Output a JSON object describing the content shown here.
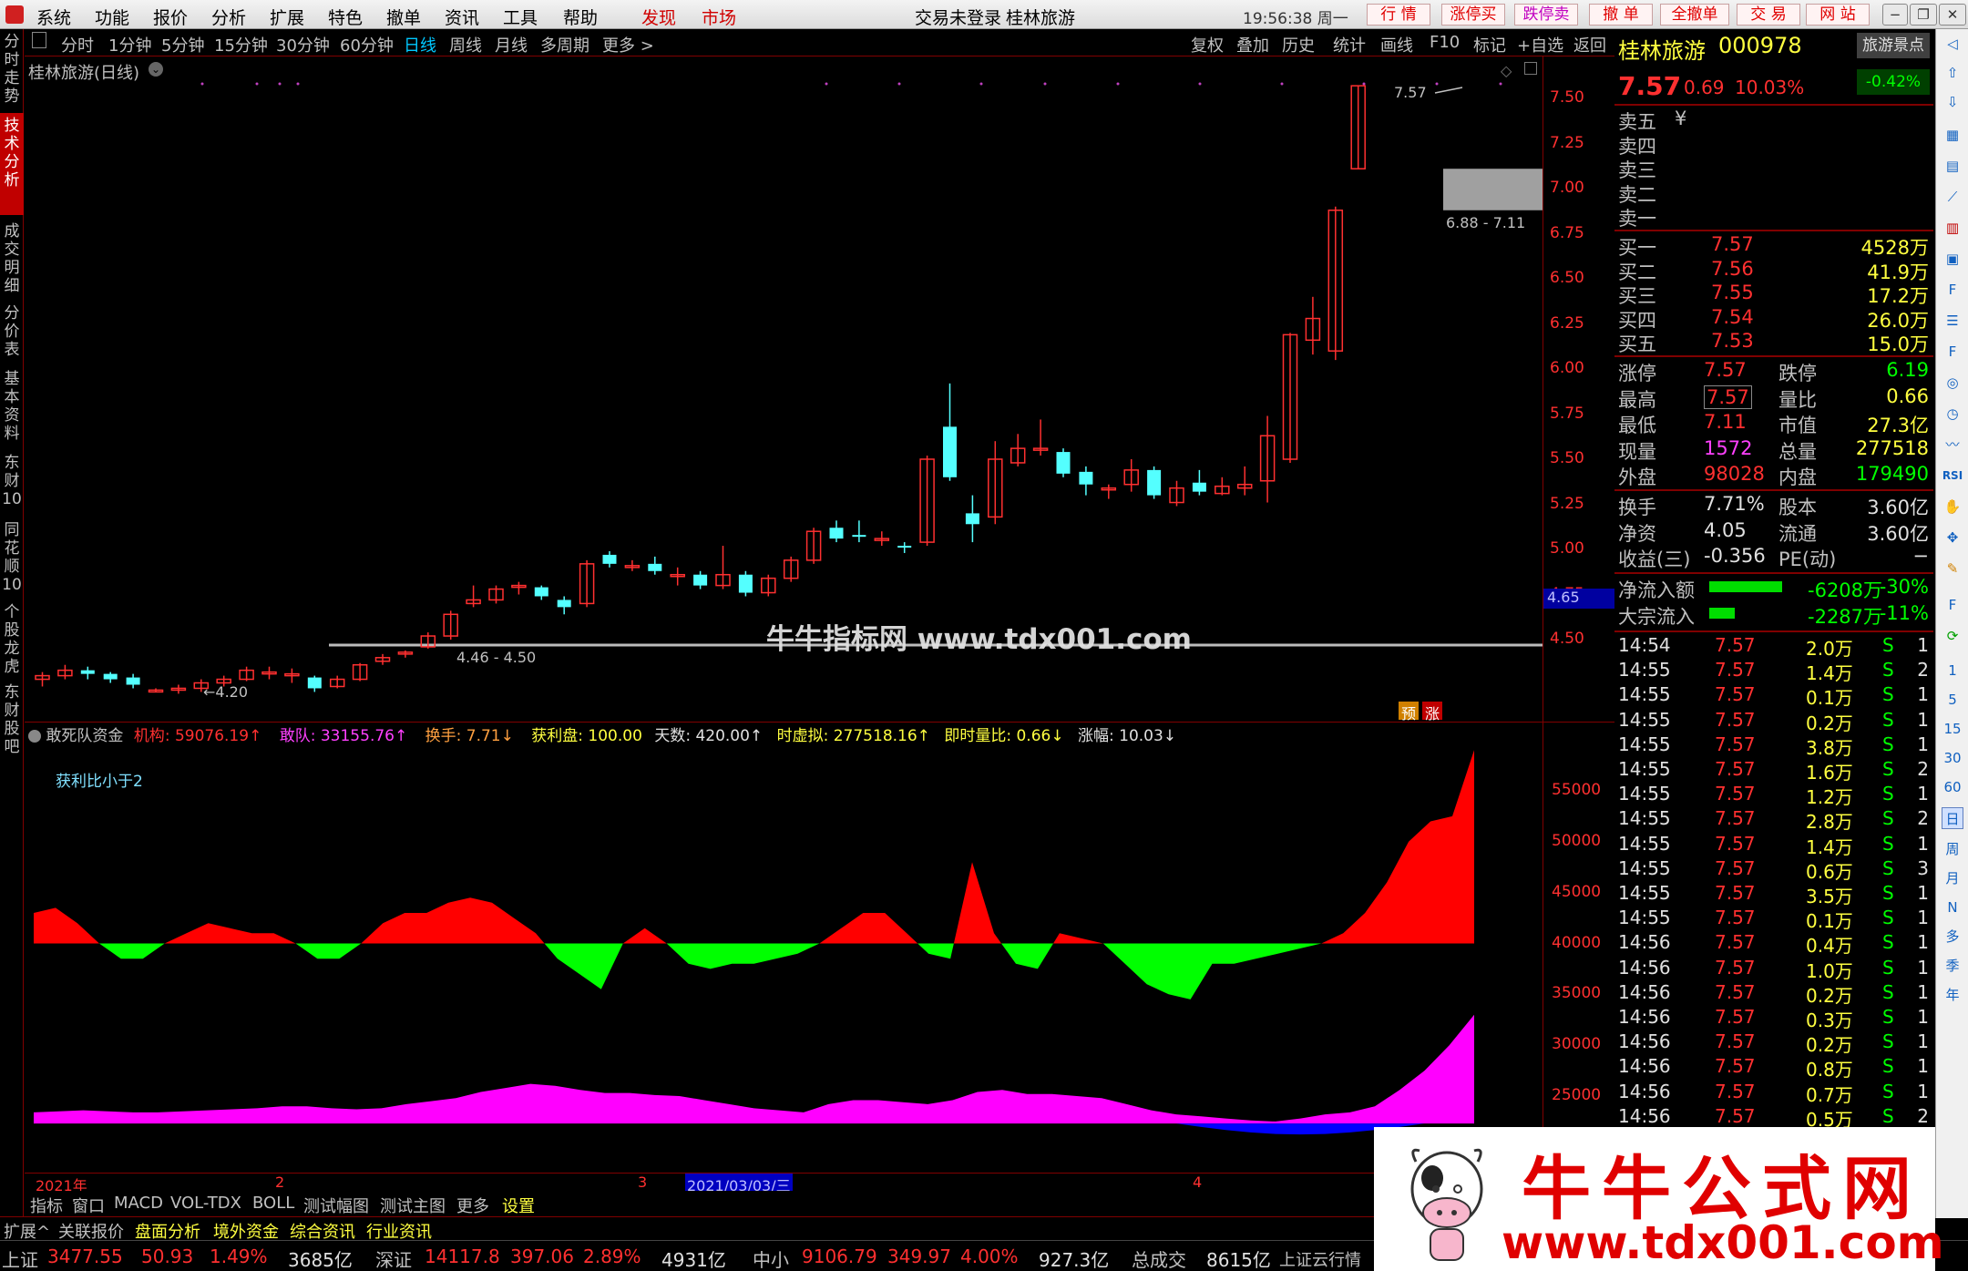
{
  "menubar": {
    "items": [
      "系统",
      "功能",
      "报价",
      "分析",
      "扩展",
      "特色",
      "撤单",
      "资讯",
      "工具",
      "帮助"
    ],
    "discover": "发现",
    "market": "市场",
    "login_status": "交易未登录",
    "stock_name": "桂林旅游",
    "clock": "19:56:38 周一",
    "buttons": [
      "行 情",
      "涨停买",
      "跌停卖",
      "撤 单",
      "全撤单",
      "交 易",
      "网 站"
    ],
    "window_controls": [
      "−",
      "❐",
      "□",
      "✕"
    ]
  },
  "leftbar": {
    "items": [
      "分时走势",
      "技术分析",
      "成交明细",
      "分价表",
      "基本资料",
      "东财10",
      "同花顺10",
      "个股龙虎",
      "东财股吧"
    ],
    "active": "技术分析"
  },
  "toolbar": {
    "periods": [
      "分时",
      "1分钟",
      "5分钟",
      "15分钟",
      "30分钟",
      "60分钟",
      "日线",
      "周线",
      "月线",
      "多周期",
      "更多 >"
    ],
    "active": "日线",
    "right": [
      "复权",
      "叠加",
      "历史",
      "统计",
      "画线",
      "F10",
      "标记",
      "+自选",
      "返回"
    ]
  },
  "main_chart": {
    "title": "桂林旅游(日线)",
    "y_labels": [
      "7.50",
      "7.25",
      "7.00",
      "6.75",
      "6.50",
      "6.25",
      "6.00",
      "5.75",
      "5.50",
      "5.25",
      "5.00",
      "4.75",
      "4.50"
    ],
    "current_price_tag": "4.65",
    "annotation_high": "7.57",
    "annotation_gap": "6.88 - 7.11",
    "annotation_support": "4.46 - 4.50",
    "annotation_low": "4.20",
    "badges": [
      "预",
      "涨"
    ],
    "watermark": "牛牛指标网 www.tdx001.com"
  },
  "chart_data": {
    "type": "candlestick",
    "ylim": [
      4.2,
      7.6
    ],
    "candles": [
      [
        4.28,
        4.3,
        4.24,
        4.32
      ],
      [
        4.3,
        4.33,
        4.28,
        4.36
      ],
      [
        4.33,
        4.31,
        4.28,
        4.35
      ],
      [
        4.31,
        4.28,
        4.26,
        4.32
      ],
      [
        4.29,
        4.25,
        4.23,
        4.31
      ],
      [
        4.22,
        4.22,
        4.21,
        4.23
      ],
      [
        4.22,
        4.23,
        4.2,
        4.25
      ],
      [
        4.23,
        4.26,
        4.21,
        4.28
      ],
      [
        4.26,
        4.28,
        4.24,
        4.3
      ],
      [
        4.28,
        4.33,
        4.27,
        4.35
      ],
      [
        4.32,
        4.32,
        4.28,
        4.35
      ],
      [
        4.31,
        4.31,
        4.26,
        4.34
      ],
      [
        4.29,
        4.23,
        4.21,
        4.3
      ],
      [
        4.24,
        4.28,
        4.23,
        4.3
      ],
      [
        4.28,
        4.36,
        4.27,
        4.37
      ],
      [
        4.38,
        4.4,
        4.36,
        4.42
      ],
      [
        4.42,
        4.43,
        4.4,
        4.44
      ],
      [
        4.46,
        4.52,
        4.45,
        4.54
      ],
      [
        4.52,
        4.64,
        4.5,
        4.66
      ],
      [
        4.7,
        4.72,
        4.68,
        4.8
      ],
      [
        4.72,
        4.78,
        4.7,
        4.8
      ],
      [
        4.8,
        4.8,
        4.75,
        4.82
      ],
      [
        4.79,
        4.74,
        4.72,
        4.8
      ],
      [
        4.72,
        4.68,
        4.64,
        4.74
      ],
      [
        4.7,
        4.92,
        4.68,
        4.94
      ],
      [
        4.97,
        4.92,
        4.9,
        4.99
      ],
      [
        4.91,
        4.91,
        4.88,
        4.94
      ],
      [
        4.92,
        4.88,
        4.86,
        4.96
      ],
      [
        4.86,
        4.86,
        4.8,
        4.9
      ],
      [
        4.86,
        4.8,
        4.78,
        4.88
      ],
      [
        4.8,
        4.86,
        4.78,
        5.02
      ],
      [
        4.86,
        4.76,
        4.74,
        4.88
      ],
      [
        4.76,
        4.84,
        4.74,
        4.86
      ],
      [
        4.84,
        4.94,
        4.82,
        4.96
      ],
      [
        4.94,
        5.1,
        4.92,
        5.12
      ],
      [
        5.12,
        5.06,
        5.04,
        5.16
      ],
      [
        5.08,
        5.07,
        5.04,
        5.16
      ],
      [
        5.06,
        5.06,
        5.02,
        5.1
      ],
      [
        5.02,
        5.01,
        4.98,
        5.04
      ],
      [
        5.04,
        5.5,
        5.02,
        5.52
      ],
      [
        5.68,
        5.4,
        5.38,
        5.92
      ],
      [
        5.2,
        5.14,
        5.04,
        5.3
      ],
      [
        5.18,
        5.5,
        5.14,
        5.6
      ],
      [
        5.48,
        5.56,
        5.46,
        5.64
      ],
      [
        5.56,
        5.56,
        5.52,
        5.72
      ],
      [
        5.54,
        5.42,
        5.4,
        5.56
      ],
      [
        5.43,
        5.36,
        5.3,
        5.46
      ],
      [
        5.34,
        5.34,
        5.28,
        5.36
      ],
      [
        5.36,
        5.44,
        5.32,
        5.5
      ],
      [
        5.44,
        5.3,
        5.28,
        5.46
      ],
      [
        5.26,
        5.34,
        5.24,
        5.38
      ],
      [
        5.37,
        5.32,
        5.3,
        5.44
      ],
      [
        5.31,
        5.35,
        5.3,
        5.4
      ],
      [
        5.34,
        5.36,
        5.3,
        5.46
      ],
      [
        5.38,
        5.63,
        5.26,
        5.74
      ],
      [
        5.5,
        6.19,
        5.48,
        6.2
      ],
      [
        6.16,
        6.28,
        6.08,
        6.4
      ],
      [
        6.1,
        6.88,
        6.05,
        6.9
      ],
      [
        7.11,
        7.57,
        7.11,
        7.57
      ]
    ],
    "gap_band": [
      6.88,
      7.11
    ],
    "support_line": 4.47
  },
  "indicator": {
    "name": "敢死队资金",
    "labels": [
      {
        "k": "机构",
        "v": "59076.19↑"
      },
      {
        "k": "敢队",
        "v": "33155.76↑"
      },
      {
        "k": "换手",
        "v": "7.71↓"
      },
      {
        "k": "获利盘",
        "v": "100.00"
      },
      {
        "k": "天数",
        "v": "420.00↑"
      },
      {
        "k": "时虚拟",
        "v": "277518.16↑"
      },
      {
        "k": "即时量比",
        "v": "0.66↓"
      },
      {
        "k": "涨幅",
        "v": "10.03↓"
      }
    ],
    "note": "获利比小于2",
    "y_labels": [
      "55000",
      "50000",
      "45000",
      "40000",
      "35000",
      "30000",
      "25000"
    ],
    "x_labels": [
      "2021年",
      "2",
      "3",
      "4"
    ],
    "cursor_date": "2021/03/03/三",
    "red_green_series": [
      43000,
      43500,
      42000,
      40000,
      38500,
      38500,
      40000,
      41000,
      42000,
      41500,
      41000,
      41000,
      40000,
      38500,
      38500,
      40000,
      42000,
      43000,
      43000,
      44000,
      44500,
      44000,
      42500,
      41000,
      38500,
      37000,
      35500,
      40000,
      41500,
      40000,
      38000,
      37500,
      38000,
      38000,
      38500,
      39000,
      40000,
      41500,
      43000,
      43000,
      41000,
      39000,
      38500,
      48000,
      41000,
      38000,
      37500,
      41000,
      40500,
      40000,
      38000,
      36000,
      35000,
      34500,
      38000,
      38000,
      38500,
      39000,
      39500,
      40000,
      41000,
      43000,
      46000,
      50000,
      52000,
      52500,
      59000
    ],
    "magenta_series": [
      23400,
      23500,
      23600,
      23500,
      23400,
      23400,
      23500,
      23600,
      23700,
      23800,
      24000,
      24000,
      23800,
      23700,
      23800,
      24200,
      24500,
      24800,
      25400,
      25800,
      26200,
      26000,
      25600,
      25300,
      25300,
      25100,
      25000,
      24600,
      24200,
      23800,
      23600,
      23400,
      24200,
      24600,
      24600,
      24400,
      24200,
      24600,
      25400,
      25600,
      25200,
      25200,
      25000,
      24800,
      24200,
      23600,
      23200,
      23000,
      22800,
      22600,
      22500,
      22800,
      23200,
      23400,
      24000,
      25600,
      27500,
      30000,
      33000
    ],
    "blue_series_range": [
      46,
      56
    ]
  },
  "quote": {
    "name": "桂林旅游",
    "code": "000978",
    "sector": "旅游景点",
    "sector_change": "-0.42%",
    "price": "7.57",
    "change": "0.69",
    "change_pct": "10.03%",
    "sells": [
      [
        "卖五",
        "¥"
      ],
      [
        "卖四",
        ""
      ],
      [
        "卖三",
        ""
      ],
      [
        "卖二",
        ""
      ],
      [
        "卖一",
        ""
      ]
    ],
    "buys": [
      [
        "买一",
        "7.57",
        "4528万"
      ],
      [
        "买二",
        "7.56",
        "41.9万"
      ],
      [
        "买三",
        "7.55",
        "17.2万"
      ],
      [
        "买四",
        "7.54",
        "26.0万"
      ],
      [
        "买五",
        "7.53",
        "15.0万"
      ]
    ],
    "stats": [
      [
        "涨停",
        "7.57",
        "跌停",
        "6.19"
      ],
      [
        "最高",
        "7.57",
        "量比",
        "0.66"
      ],
      [
        "最低",
        "7.11",
        "市值",
        "27.3亿"
      ],
      [
        "现量",
        "1572",
        "总量",
        "277518"
      ],
      [
        "外盘",
        "98028",
        "内盘",
        "179490"
      ]
    ],
    "stats2": [
      [
        "换手",
        "7.71%",
        "股本",
        "3.60亿"
      ],
      [
        "净资",
        "4.05",
        "流通",
        "3.60亿"
      ],
      [
        "收益(三)",
        "-0.356",
        "PE(动)",
        "−"
      ]
    ],
    "flow": [
      {
        "label": "净流入额",
        "value": "-6208万",
        "pct": "-30%",
        "bar": 0.85
      },
      {
        "label": "大宗流入",
        "value": "-2287万",
        "pct": "-11%",
        "bar": 0.3
      }
    ],
    "ticks": [
      [
        "14:54",
        "7.57",
        "2.0万",
        "S",
        "1"
      ],
      [
        "14:55",
        "7.57",
        "1.4万",
        "S",
        "2"
      ],
      [
        "14:55",
        "7.57",
        "0.1万",
        "S",
        "1"
      ],
      [
        "14:55",
        "7.57",
        "0.2万",
        "S",
        "1"
      ],
      [
        "14:55",
        "7.57",
        "3.8万",
        "S",
        "1"
      ],
      [
        "14:55",
        "7.57",
        "1.6万",
        "S",
        "2"
      ],
      [
        "14:55",
        "7.57",
        "1.2万",
        "S",
        "1"
      ],
      [
        "14:55",
        "7.57",
        "2.8万",
        "S",
        "2"
      ],
      [
        "14:55",
        "7.57",
        "1.4万",
        "S",
        "1"
      ],
      [
        "14:55",
        "7.57",
        "0.6万",
        "S",
        "3"
      ],
      [
        "14:55",
        "7.57",
        "3.5万",
        "S",
        "1"
      ],
      [
        "14:55",
        "7.57",
        "0.1万",
        "S",
        "1"
      ],
      [
        "14:56",
        "7.57",
        "0.4万",
        "S",
        "1"
      ],
      [
        "14:56",
        "7.57",
        "1.0万",
        "S",
        "1"
      ],
      [
        "14:56",
        "7.57",
        "0.2万",
        "S",
        "1"
      ],
      [
        "14:56",
        "7.57",
        "0.3万",
        "S",
        "1"
      ],
      [
        "14:56",
        "7.57",
        "0.2万",
        "S",
        "1"
      ],
      [
        "14:56",
        "7.57",
        "0.8万",
        "S",
        "1"
      ],
      [
        "14:56",
        "7.57",
        "0.7万",
        "S",
        "1"
      ],
      [
        "14:56",
        "7.57",
        "0.5万",
        "S",
        "2"
      ]
    ]
  },
  "rightbar": {
    "items": [
      "1",
      "5",
      "15",
      "30",
      "60",
      "日",
      "周",
      "月",
      "N",
      "多",
      "季",
      "年"
    ]
  },
  "bottom_tabs": [
    "指标",
    "窗口",
    "MACD",
    "VOL-TDX",
    "BOLL",
    "测试幅图",
    "测试主图",
    "更多",
    "设置"
  ],
  "ext_tabs": [
    "扩展^",
    "关联报价",
    "盘面分析",
    "境外资金",
    "综合资讯",
    "行业资讯"
  ],
  "status": {
    "items": [
      {
        "name": "上证",
        "v1": "3477.55",
        "v2": "50.93",
        "v3": "1.49%",
        "v4": "3685亿"
      },
      {
        "name": "深证",
        "v1": "14117.8",
        "v2": "397.06",
        "v3": "2.89%",
        "v4": "4931亿"
      },
      {
        "name": "中小",
        "v1": "9106.79",
        "v2": "349.97",
        "v3": "4.00%",
        "v4": "927.3亿"
      }
    ],
    "total_label": "总成交",
    "total_value": "8615亿",
    "extra": "上证云行情"
  },
  "ad": {
    "title": "牛牛公式网",
    "url": "www.tdx001.com"
  },
  "colors": {
    "up": "#ff3030",
    "down": "#54ffff",
    "magenta": "#ff00ff",
    "green": "#00ff00",
    "blue": "#0000ff",
    "frame": "#800000"
  }
}
